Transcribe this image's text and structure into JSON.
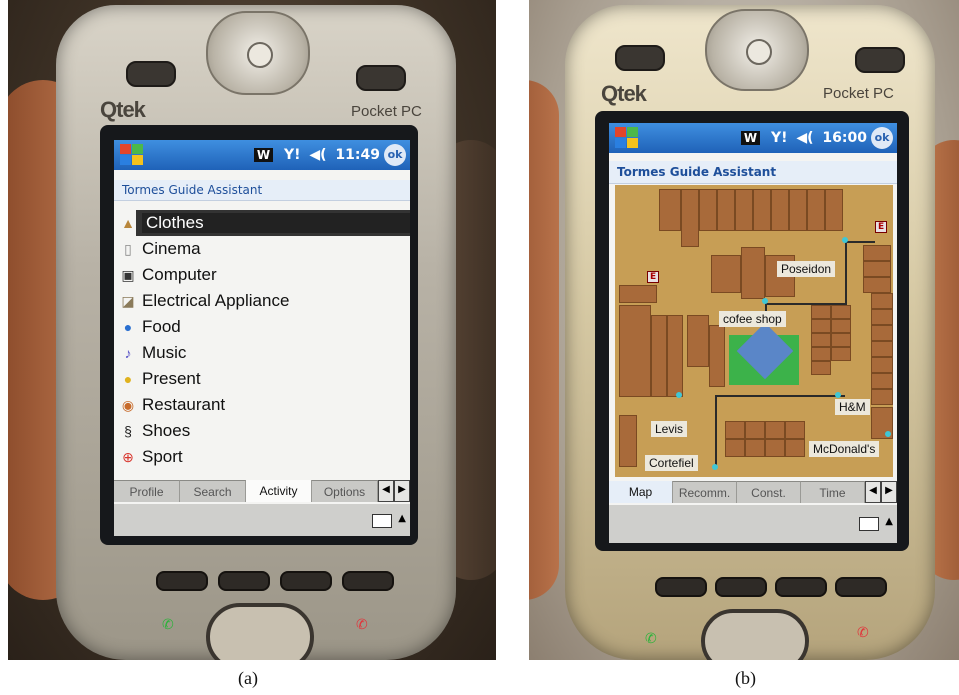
{
  "panel_a": {
    "caption": "(a)",
    "device_brand": "Qtek",
    "device_model": "Pocket PC",
    "status": {
      "w": "W",
      "signal": "Y!",
      "volume": "◀(",
      "time": "11:49",
      "ok": "ok"
    },
    "app_title": "Tormes Guide Assistant",
    "menu_items": [
      {
        "label": "Clothes",
        "icon": "hat-icon"
      },
      {
        "label": "Cinema",
        "icon": "film-icon"
      },
      {
        "label": "Computer",
        "icon": "computer-icon"
      },
      {
        "label": "Electrical Appliance",
        "icon": "appliance-icon"
      },
      {
        "label": "Food",
        "icon": "food-icon"
      },
      {
        "label": "Music",
        "icon": "music-icon"
      },
      {
        "label": "Present",
        "icon": "present-icon"
      },
      {
        "label": "Restaurant",
        "icon": "restaurant-icon"
      },
      {
        "label": "Shoes",
        "icon": "shoes-icon"
      },
      {
        "label": "Sport",
        "icon": "sport-icon"
      }
    ],
    "selected_index": 0,
    "tabs": [
      "Profile",
      "Search",
      "Activity",
      "Options"
    ],
    "active_tab": "Activity"
  },
  "panel_b": {
    "caption": "(b)",
    "device_brand": "Qtek",
    "device_model": "Pocket PC",
    "status": {
      "w": "W",
      "signal": "Y!",
      "volume": "◀(",
      "time": "16:00",
      "ok": "ok"
    },
    "app_title": "Tormes Guide Assistant",
    "map_labels": {
      "poseidon": "Poseidon",
      "cofee_shop": "cofee shop",
      "hm": "H&M",
      "levis": "Levis",
      "cortefiel": "Cortefiel",
      "mcdonalds": "McDonald's"
    },
    "exit_labels": [
      "E",
      "E"
    ],
    "tabs": [
      "Map",
      "Recomm.",
      "Const.",
      "Time"
    ],
    "active_tab": "Map"
  }
}
